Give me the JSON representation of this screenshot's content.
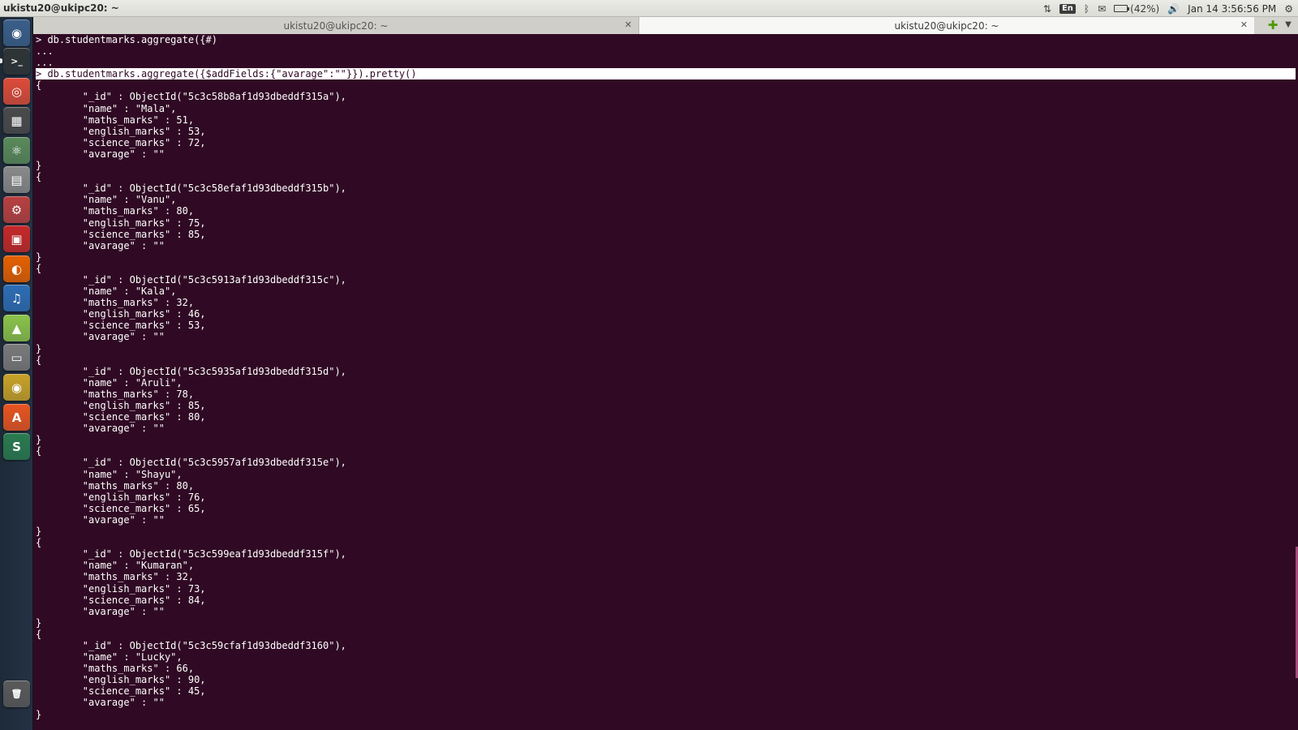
{
  "top_panel": {
    "window_title": "ukistu20@ukipc20: ~",
    "keyboard_layout": "En",
    "battery_percent": "(42%)",
    "battery_level": 0.42,
    "clock": "Jan 14  3:56:56 PM",
    "icons": [
      "network-updown-icon",
      "keyboard-icon",
      "bluetooth-icon",
      "mail-icon",
      "battery-icon",
      "volume-icon",
      "settings-gear-icon"
    ]
  },
  "launcher": {
    "items": [
      {
        "name": "dash-home-icon",
        "glyph": "◉",
        "color": "#3a5f8a"
      },
      {
        "name": "terminal-icon",
        "glyph": ">_",
        "color": "#2e3436"
      },
      {
        "name": "chrome-icon",
        "glyph": "◎",
        "color": "#dd4b39"
      },
      {
        "name": "workspace-switcher-icon",
        "glyph": "▦",
        "color": "#4a4a4a"
      },
      {
        "name": "atom-icon",
        "glyph": "⚛",
        "color": "#5a8a5a"
      },
      {
        "name": "files-icon",
        "glyph": "▤",
        "color": "#8a8a8a"
      },
      {
        "name": "system-settings-icon",
        "glyph": "⚙",
        "color": "#b94040"
      },
      {
        "name": "image-viewer-icon",
        "glyph": "▣",
        "color": "#c62828"
      },
      {
        "name": "firefox-icon",
        "glyph": "◐",
        "color": "#e66000"
      },
      {
        "name": "music-player-icon",
        "glyph": "♫",
        "color": "#2d6db5"
      },
      {
        "name": "android-icon",
        "glyph": "▲",
        "color": "#8bc34a"
      },
      {
        "name": "drive-icon",
        "glyph": "▭",
        "color": "#7a7a7a"
      },
      {
        "name": "disc-burner-icon",
        "glyph": "◉",
        "color": "#c9a227"
      },
      {
        "name": "software-center-icon",
        "glyph": "A",
        "color": "#e95420"
      },
      {
        "name": "slides-icon",
        "glyph": "S",
        "color": "#2a7b4f"
      },
      {
        "name": "trash-icon",
        "glyph": "🗑",
        "color": "#5a5a5a"
      }
    ]
  },
  "tabs": [
    {
      "label": "ukistu20@ukipc20: ~",
      "active": false
    },
    {
      "label": "ukistu20@ukipc20: ~",
      "active": true
    }
  ],
  "terminal": {
    "lines": [
      "> db.studentmarks.aggregate({#)",
      "...",
      "...",
      "> db.studentmarks.aggregate({$addFields:{\"avarage\":\"\"}}).pretty()",
      "{",
      "        \"_id\" : ObjectId(\"5c3c58b8af1d93dbeddf315a\"),",
      "        \"name\" : \"Mala\",",
      "        \"maths_marks\" : 51,",
      "        \"english_marks\" : 53,",
      "        \"science_marks\" : 72,",
      "        \"avarage\" : \"\"",
      "}",
      "{",
      "        \"_id\" : ObjectId(\"5c3c58efaf1d93dbeddf315b\"),",
      "        \"name\" : \"Vanu\",",
      "        \"maths_marks\" : 80,",
      "        \"english_marks\" : 75,",
      "        \"science_marks\" : 85,",
      "        \"avarage\" : \"\"",
      "}",
      "{",
      "        \"_id\" : ObjectId(\"5c3c5913af1d93dbeddf315c\"),",
      "        \"name\" : \"Kala\",",
      "        \"maths_marks\" : 32,",
      "        \"english_marks\" : 46,",
      "        \"science_marks\" : 53,",
      "        \"avarage\" : \"\"",
      "}",
      "{",
      "        \"_id\" : ObjectId(\"5c3c5935af1d93dbeddf315d\"),",
      "        \"name\" : \"Aruli\",",
      "        \"maths_marks\" : 78,",
      "        \"english_marks\" : 85,",
      "        \"science_marks\" : 80,",
      "        \"avarage\" : \"\"",
      "}",
      "{",
      "        \"_id\" : ObjectId(\"5c3c5957af1d93dbeddf315e\"),",
      "        \"name\" : \"Shayu\",",
      "        \"maths_marks\" : 80,",
      "        \"english_marks\" : 76,",
      "        \"science_marks\" : 65,",
      "        \"avarage\" : \"\"",
      "}",
      "{",
      "        \"_id\" : ObjectId(\"5c3c599eaf1d93dbeddf315f\"),",
      "        \"name\" : \"Kumaran\",",
      "        \"maths_marks\" : 32,",
      "        \"english_marks\" : 73,",
      "        \"science_marks\" : 84,",
      "        \"avarage\" : \"\"",
      "}",
      "{",
      "        \"_id\" : ObjectId(\"5c3c59cfaf1d93dbeddf3160\"),",
      "        \"name\" : \"Lucky\",",
      "        \"maths_marks\" : 66,",
      "        \"english_marks\" : 90,",
      "        \"science_marks\" : 45,",
      "        \"avarage\" : \"\"",
      "}"
    ],
    "highlighted_line": 3,
    "colors": {
      "background": "#300a24",
      "foreground": "#ffffff",
      "scrollbar": "#a64c7d"
    }
  }
}
